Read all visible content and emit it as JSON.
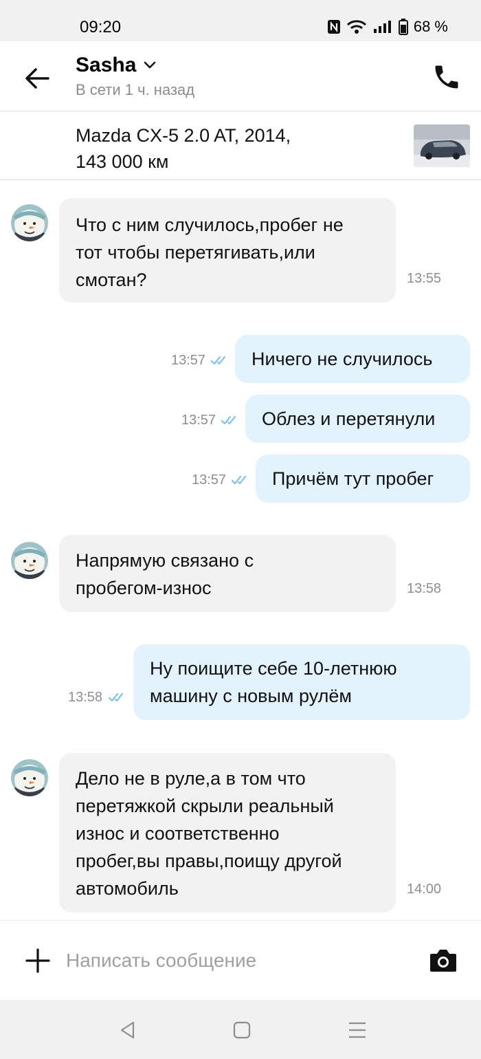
{
  "status_bar": {
    "time": "09:20",
    "battery": "68 %",
    "icons": [
      "nfc-icon",
      "wifi-icon",
      "signal-icon",
      "battery-icon"
    ]
  },
  "header": {
    "contact_name": "Sasha",
    "contact_status": "В сети 1 ч. назад",
    "icons": [
      "back-arrow-icon",
      "chevron-down-icon",
      "phone-icon"
    ]
  },
  "listing": {
    "title": "Mazda CX-5 2.0 AT, 2014,\n143 000 км"
  },
  "messages": [
    {
      "direction": "in",
      "text": "Что с ним случилось,пробег не\nтот чтобы перетягивать,или\nсмотан?",
      "time": "13:55"
    },
    {
      "direction": "out",
      "text": "Ничего не случилось",
      "time": "13:57"
    },
    {
      "direction": "out",
      "text": "Облез и перетянули",
      "time": "13:57"
    },
    {
      "direction": "out",
      "text": "Причём тут пробег",
      "time": "13:57"
    },
    {
      "direction": "in",
      "text": "Напрямую связано с\nпробегом-износ",
      "time": "13:58"
    },
    {
      "direction": "out",
      "text": "Ну поищите себе 10-летнюю\nмашину с новым рулём",
      "time": "13:58"
    },
    {
      "direction": "in",
      "text": "Дело не в руле,а в том что\nперетяжкой скрыли реальный\nизнос и соответственно\nпробег,вы правы,поищу другой\nавтомобиль",
      "time": "14:00"
    }
  ],
  "composer": {
    "placeholder": "Написать сообщение",
    "value": "",
    "icons": [
      "plus-icon",
      "camera-icon"
    ]
  },
  "nav_bar": {
    "icons": [
      "nav-back-icon",
      "nav-home-icon",
      "nav-menu-icon"
    ]
  },
  "colors": {
    "incoming_bubble": "#f2f2f2",
    "outgoing_bubble": "#e3f3fd",
    "read_ticks": "#7cc3ea",
    "timestamp": "#8e8e8e"
  }
}
